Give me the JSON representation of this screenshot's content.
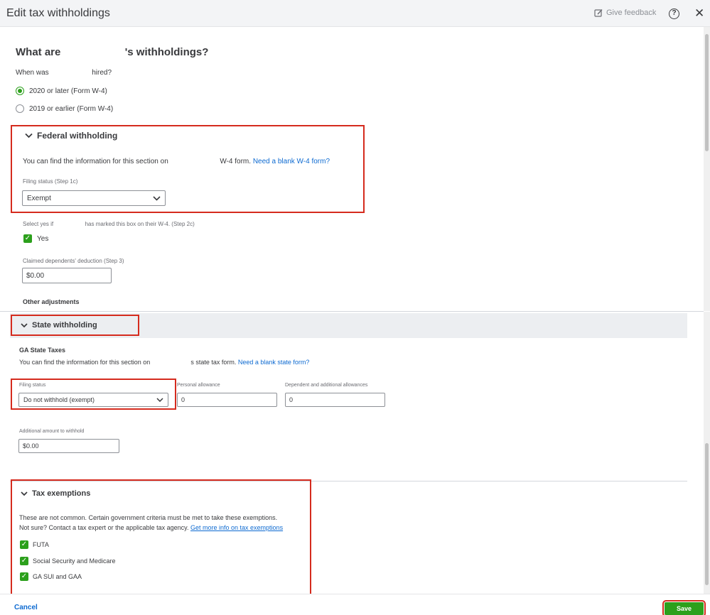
{
  "header": {
    "title": "Edit tax withholdings",
    "give_feedback": "Give feedback",
    "help": "?",
    "close": "✕"
  },
  "main": {
    "question_prefix": "What are",
    "question_suffix": "'s withholdings?",
    "hired_prefix": "When was",
    "hired_suffix": "hired?",
    "radio_options": [
      {
        "label": "2020 or later (Form W-4)",
        "selected": true
      },
      {
        "label": "2019 or earlier (Form W-4)",
        "selected": false
      }
    ]
  },
  "federal": {
    "title": "Federal withholding",
    "info_prefix": "You can find the information for this section on",
    "info_suffix": "W-4 form.",
    "blank_link": "Need a blank W-4 form?",
    "filing_label": "Filing status (Step 1c)",
    "filing_value": "Exempt",
    "select_yes_prefix": "Select yes if",
    "select_yes_suffix": "has marked this box on their W-4. (Step 2c)",
    "yes_label": "Yes",
    "dependents_label": "Claimed dependents' deduction (Step 3)",
    "dependents_value": "$0.00",
    "other_adjustments": "Other adjustments"
  },
  "state": {
    "title": "State withholding",
    "subtitle": "GA State Taxes",
    "info_prefix": "You can find the information for this section on",
    "info_suffix": "s state tax form.",
    "blank_link": "Need a blank state form?",
    "filing_label": "Filing status",
    "filing_value": "Do not withhold (exempt)",
    "personal_label": "Personal allowance",
    "personal_value": "0",
    "dependent_label": "Dependent and additional allowances",
    "dependent_value": "0",
    "additional_label": "Additional amount to withhold",
    "additional_value": "$0.00"
  },
  "exemptions": {
    "title": "Tax exemptions",
    "line1": "These are not common. Certain government criteria must be met to take these exemptions.",
    "line2": "Not sure? Contact a tax expert or the applicable tax agency.",
    "more_link": "Get more info on tax exemptions",
    "items": [
      {
        "label": "FUTA",
        "checked": true
      },
      {
        "label": "Social Security and Medicare",
        "checked": true
      },
      {
        "label": "GA SUI and GAA",
        "checked": true
      }
    ]
  },
  "footer": {
    "cancel": "Cancel",
    "save": "Save"
  },
  "colors": {
    "accent_green": "#2ca01c",
    "link_blue": "#0d6ad1",
    "highlight_red": "#d52b1e"
  }
}
